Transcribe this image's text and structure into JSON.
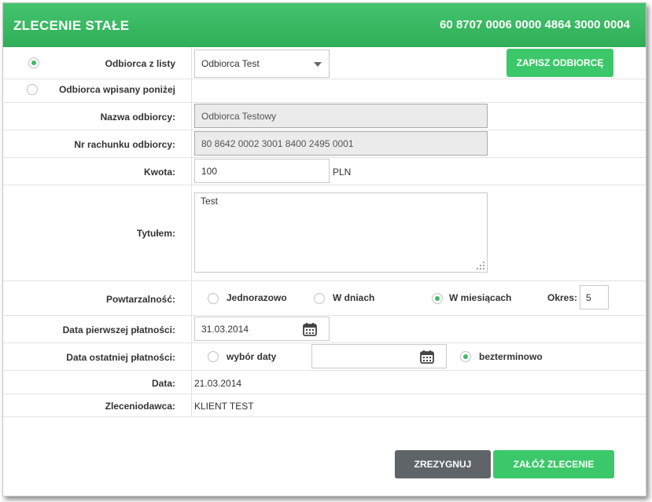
{
  "header": {
    "title": "ZLECENIE STAŁE",
    "account": "60 8707 0006 0000 4864 3000 0004"
  },
  "recipient_source": {
    "from_list_label": "Odbiorca z listy",
    "from_list_selected": true,
    "selected_recipient": "Odbiorca Test",
    "manual_label": "Odbiorca wpisany poniżej",
    "manual_selected": false,
    "save_button": "ZAPISZ ODBIORCĘ"
  },
  "recipient_name": {
    "label": "Nazwa odbiorcy:",
    "value": "Odbiorca Testowy"
  },
  "recipient_account": {
    "label": "Nr rachunku odbiorcy:",
    "value": "80 8642 0002 3001 8400 2495 0001"
  },
  "amount": {
    "label": "Kwota:",
    "value": "100",
    "currency": "PLN"
  },
  "title_field": {
    "label": "Tytułem:",
    "value": "Test"
  },
  "frequency": {
    "label": "Powtarzalność:",
    "options": [
      {
        "label": "Jednorazowo",
        "selected": false
      },
      {
        "label": "W dniach",
        "selected": false
      },
      {
        "label": "W miesiącach",
        "selected": true
      }
    ],
    "period_label": "Okres:",
    "period_value": "5"
  },
  "first_payment": {
    "label": "Data pierwszej płatności:",
    "value": "31.03.2014"
  },
  "last_payment": {
    "label": "Data ostatniej płatności:",
    "date_option": "wybór daty",
    "date_selected": false,
    "date_value": "",
    "indefinite_option": "bezterminowo",
    "indefinite_selected": true
  },
  "date": {
    "label": "Data:",
    "value": "21.03.2014"
  },
  "principal": {
    "label": "Zleceniodawca:",
    "value": "KLIENT TEST"
  },
  "actions": {
    "cancel": "ZREZYGNUJ",
    "submit": "ZAŁÓŻ ZLECENIE"
  },
  "colors": {
    "accent": "#3cc86a",
    "header": "#38b863",
    "dark_button": "#5e6467"
  },
  "icons": {
    "calendar": "calendar-icon",
    "dropdown": "chevron-down-icon",
    "resize": "resize-handle-icon"
  }
}
